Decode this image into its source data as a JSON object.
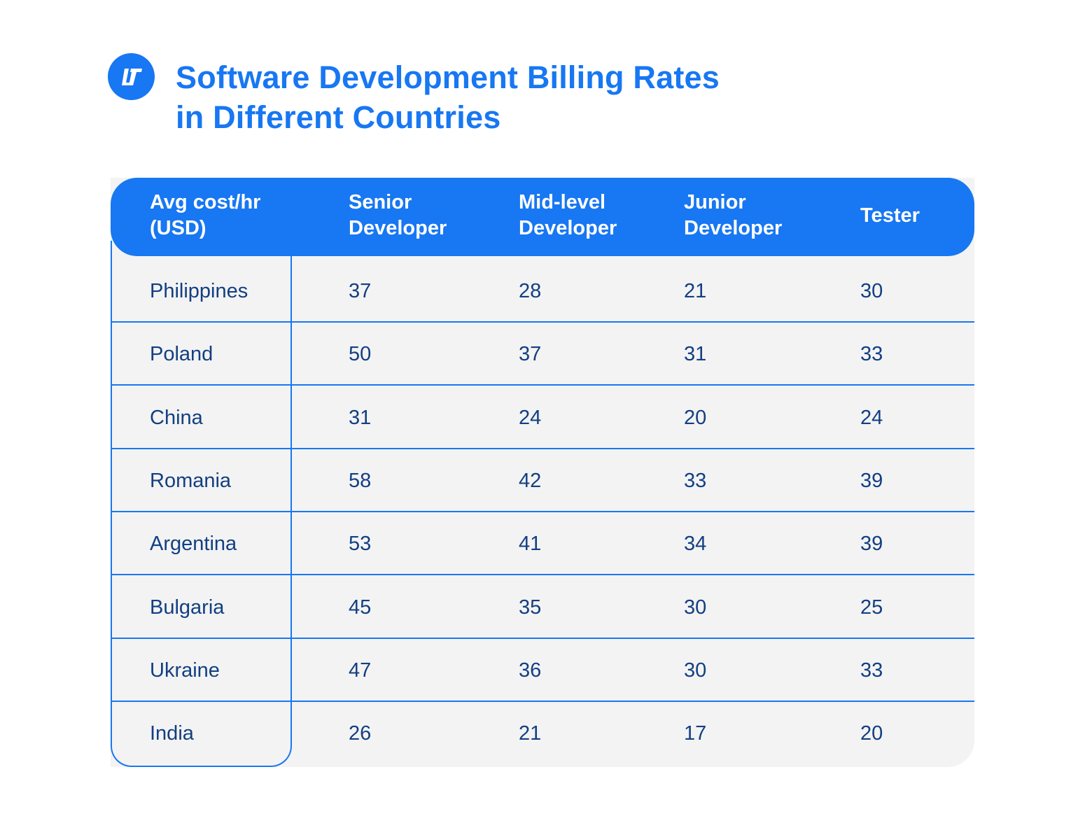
{
  "header": {
    "logo_icon": "brand-logo-icon",
    "title_line1": "Software Development Billing Rates",
    "title_line2": "in Different Countries",
    "accent_color": "#1877f2",
    "text_color": "#123f82"
  },
  "table": {
    "columns": [
      {
        "line1": "Avg cost/hr",
        "line2": "(USD)"
      },
      {
        "line1": "Senior",
        "line2": "Developer"
      },
      {
        "line1": "Mid-level",
        "line2": "Developer"
      },
      {
        "line1": "Junior",
        "line2": "Developer"
      },
      {
        "line1": "Tester",
        "line2": ""
      }
    ],
    "rows": [
      {
        "country": "Philippines",
        "senior": "37",
        "mid": "28",
        "junior": "21",
        "tester": "30"
      },
      {
        "country": "Poland",
        "senior": "50",
        "mid": "37",
        "junior": "31",
        "tester": "33"
      },
      {
        "country": "China",
        "senior": "31",
        "mid": "24",
        "junior": "20",
        "tester": "24"
      },
      {
        "country": "Romania",
        "senior": "58",
        "mid": "42",
        "junior": "33",
        "tester": "39"
      },
      {
        "country": "Argentina",
        "senior": "53",
        "mid": "41",
        "junior": "34",
        "tester": "39"
      },
      {
        "country": "Bulgaria",
        "senior": "45",
        "mid": "35",
        "junior": "30",
        "tester": "25"
      },
      {
        "country": "Ukraine",
        "senior": "47",
        "mid": "36",
        "junior": "30",
        "tester": "33"
      },
      {
        "country": "India",
        "senior": "26",
        "mid": "21",
        "junior": "17",
        "tester": "20"
      }
    ]
  }
}
